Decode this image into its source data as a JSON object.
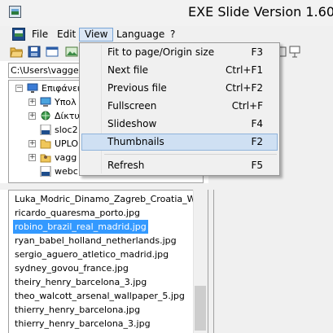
{
  "window": {
    "title": "EXE Slide Version 1.60"
  },
  "menubar": {
    "items": [
      "File",
      "Edit",
      "View",
      "Language",
      "?"
    ]
  },
  "view_menu": {
    "items": [
      {
        "label": "Fit to page/Origin size",
        "shortcut": "F3"
      },
      {
        "label": "Next file",
        "shortcut": "Ctrl+F1"
      },
      {
        "label": "Previous file",
        "shortcut": "Ctrl+F2"
      },
      {
        "label": "Fullscreen",
        "shortcut": "Ctrl+F"
      },
      {
        "label": "Slideshow",
        "shortcut": "F4"
      },
      {
        "label": "Thumbnails",
        "shortcut": "F2",
        "highlighted": true
      },
      {
        "label": "Refresh",
        "shortcut": "F5"
      }
    ]
  },
  "path": {
    "value": "C:\\Users\\vaggelis"
  },
  "tree": {
    "items": [
      {
        "label": "Επιφάνεια",
        "icon": "desktop-icon"
      },
      {
        "label": "Υπολ",
        "icon": "computer-icon"
      },
      {
        "label": "Δίκτυ",
        "icon": "network-icon"
      },
      {
        "label": "sloc2",
        "icon": "zip-icon"
      },
      {
        "label": "UPLO",
        "icon": "folder-icon"
      },
      {
        "label": "vagg",
        "icon": "user-folder-icon"
      },
      {
        "label": "webc",
        "icon": "zip-icon"
      }
    ]
  },
  "files": {
    "items": [
      "Luka_Modric_Dinamo_Zagreb_Croatia_Wal...",
      "ricardo_quaresma_porto.jpg",
      "robino_brazil_real_madrid.jpg",
      "ryan_babel_holland_netherlands.jpg",
      "sergio_aguero_atletico_madrid.jpg",
      "sydney_govou_france.jpg",
      "theiry_henry_barcelona_3.jpg",
      "theo_walcott_arsenal_wallpaper_5.jpg",
      "thierry_henry_barcelona.jpg",
      "thierry_henry_barcelona_3.jpg"
    ],
    "selected_index": 2
  },
  "colors": {
    "selection": "#3399ff",
    "menu_highlight": "#cfe0f3",
    "menu_open": "#dbe6f4"
  }
}
